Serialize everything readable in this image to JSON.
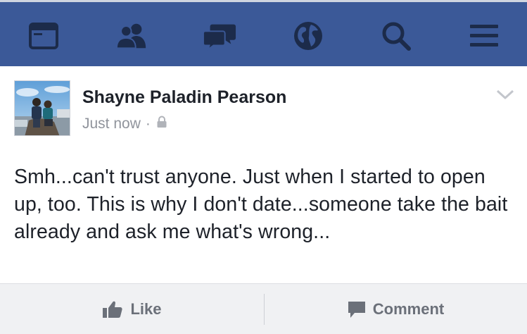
{
  "nav": {
    "items": [
      {
        "icon": "news-feed-icon"
      },
      {
        "icon": "friends-icon"
      },
      {
        "icon": "messages-icon"
      },
      {
        "icon": "globe-icon"
      },
      {
        "icon": "search-icon"
      },
      {
        "icon": "menu-icon"
      }
    ],
    "colors": {
      "bar": "#3b5998",
      "icon": "#1c2b4a"
    }
  },
  "post": {
    "author": "Shayne Paladin Pearson",
    "timestamp": "Just now",
    "separator": "·",
    "privacy_icon": "lock-icon",
    "text": "Smh...can't trust anyone. Just when I started to open up, too. This is why I don't date...someone take the bait already and ask me what's wrong..."
  },
  "actions": {
    "like_label": "Like",
    "comment_label": "Comment"
  }
}
